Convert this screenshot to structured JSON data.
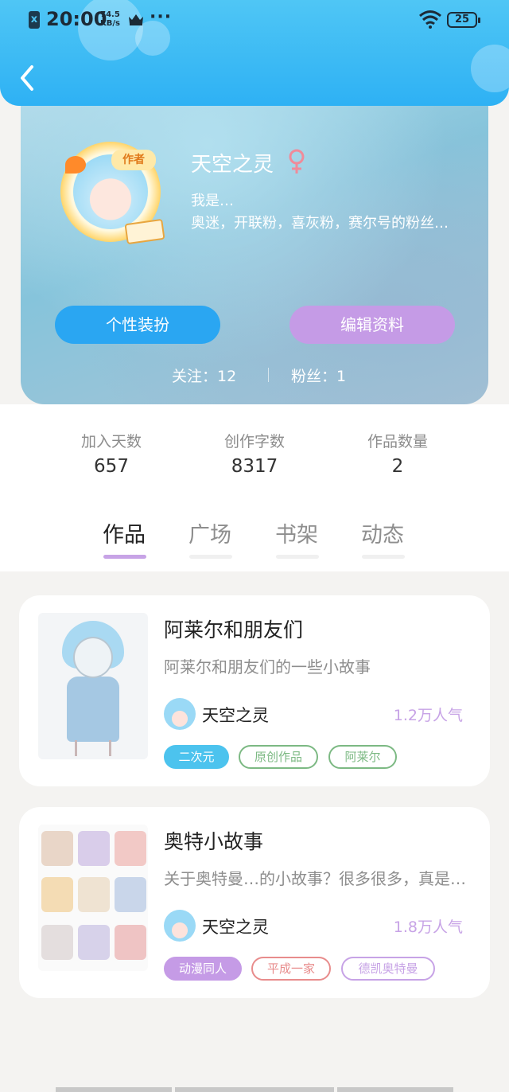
{
  "status_bar": {
    "sim_icon": "x",
    "time": "20:00",
    "speed_value": "74.5",
    "speed_unit": "KB/s",
    "more": "···",
    "battery": "25"
  },
  "profile": {
    "name": "天空之灵",
    "gender_symbol": "♀",
    "avatar_badge": "作者",
    "bio_line1": "我是…",
    "bio_line2": "奥迷，开联粉，喜灰粉，赛尔号的粉丝…",
    "btn_dress": "个性装扮",
    "btn_edit": "编辑资料",
    "following": "关注：12",
    "fans": "粉丝：1"
  },
  "stats": [
    {
      "label": "加入天数",
      "value": "657"
    },
    {
      "label": "创作字数",
      "value": "8317"
    },
    {
      "label": "作品数量",
      "value": "2"
    }
  ],
  "tabs": [
    "作品",
    "广场",
    "书架",
    "动态"
  ],
  "works": [
    {
      "title": "阿莱尔和朋友们",
      "desc": "阿莱尔和朋友们的一些小故事",
      "author": "天空之灵",
      "popularity": "1.2万人气",
      "tags": [
        "二次元",
        "原创作品",
        "阿莱尔"
      ]
    },
    {
      "title": "奥特小故事",
      "desc": "关于奥特曼…的小故事？很多很多，真是…",
      "author": "天空之灵",
      "popularity": "1.8万人气",
      "tags": [
        "动漫同人",
        "平成一家",
        "德凯奥特曼"
      ]
    }
  ],
  "colors": {
    "accent_blue": "#2aa6f2",
    "accent_purple": "#c59be6",
    "tag_green": "#7cb983",
    "tag_red": "#e88c8c"
  }
}
